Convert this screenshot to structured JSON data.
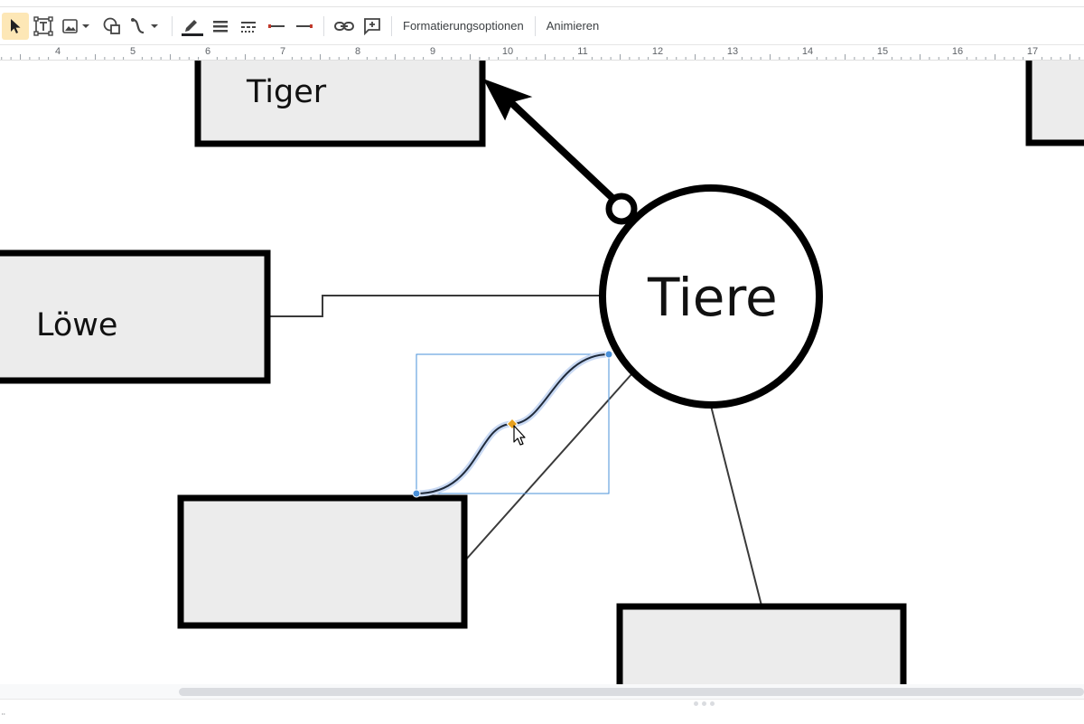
{
  "toolbar": {
    "tools": [
      {
        "name": "select-tool",
        "icon": "pointer-arrow-icon",
        "active": true
      },
      {
        "name": "text-box-tool",
        "icon": "text-box-icon"
      },
      {
        "name": "image-tool",
        "icon": "image-icon"
      },
      {
        "name": "shape-tool",
        "icon": "shape-icon"
      },
      {
        "name": "line-tool",
        "icon": "line-curve-icon"
      },
      {
        "name": "border-color-tool",
        "icon": "pen-icon"
      },
      {
        "name": "border-weight-tool",
        "icon": "line-weight-icon"
      },
      {
        "name": "border-dash-tool",
        "icon": "line-dash-icon"
      },
      {
        "name": "line-start-tool",
        "icon": "line-start-icon"
      },
      {
        "name": "line-end-tool",
        "icon": "line-end-icon"
      },
      {
        "name": "link-tool",
        "icon": "link-icon"
      },
      {
        "name": "comment-tool",
        "icon": "add-comment-icon"
      }
    ],
    "format_options_label": "Formatierungsoptionen",
    "animate_label": "Animieren",
    "active_color": "#fde7b6"
  },
  "ruler": {
    "numbers": [
      "4",
      "5",
      "6",
      "7",
      "8",
      "9",
      "10",
      "11",
      "12",
      "13",
      "14",
      "15",
      "16",
      "17"
    ]
  },
  "canvas": {
    "shapes": {
      "tiger_label": "Tiger",
      "loewe_label": "Löwe",
      "tiere_label": "Tiere"
    },
    "selection_color": "#4a90d9",
    "shape_fill": "#ececec",
    "handle_color": "#e6a01e"
  },
  "status": {
    "bottom_glyph": "¨"
  }
}
